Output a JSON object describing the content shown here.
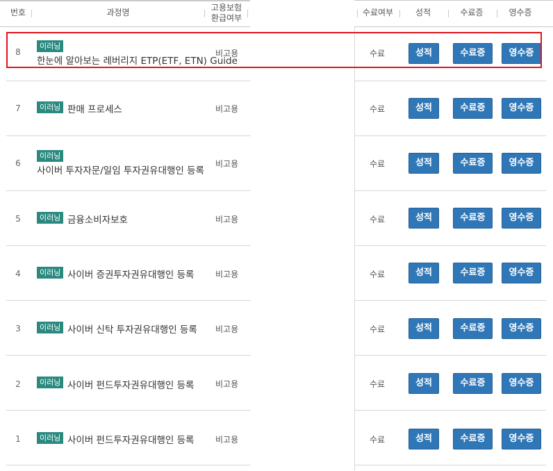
{
  "header": {
    "col_no": "번호",
    "col_course": "과정명",
    "col_insurance_line1": "고용보험",
    "col_insurance_line2": "환급여부",
    "col_completion": "수료여부",
    "col_grade": "성적",
    "col_certificate": "수료증",
    "col_receipt": "영수증"
  },
  "rows": [
    {
      "no": "8",
      "badge": "이러닝",
      "title": "한눈에 알아보는 레버리지 ETP(ETF, ETN) Guide",
      "refund": "비고용",
      "status": "수료",
      "grade_btn": "성적",
      "cert_btn": "수료증",
      "receipt_btn": "영수증"
    },
    {
      "no": "7",
      "badge": "이러닝",
      "title": "판매 프로세스",
      "refund": "비고용",
      "status": "수료",
      "grade_btn": "성적",
      "cert_btn": "수료증",
      "receipt_btn": "영수증"
    },
    {
      "no": "6",
      "badge": "이러닝",
      "title": "사이버 투자자문/일임 투자권유대행인 등록",
      "refund": "비고용",
      "status": "수료",
      "grade_btn": "성적",
      "cert_btn": "수료증",
      "receipt_btn": "영수증"
    },
    {
      "no": "5",
      "badge": "이러닝",
      "title": "금융소비자보호",
      "refund": "비고용",
      "status": "수료",
      "grade_btn": "성적",
      "cert_btn": "수료증",
      "receipt_btn": "영수증"
    },
    {
      "no": "4",
      "badge": "이러닝",
      "title": "사이버 증권투자권유대행인 등록",
      "refund": "비고용",
      "status": "수료",
      "grade_btn": "성적",
      "cert_btn": "수료증",
      "receipt_btn": "영수증"
    },
    {
      "no": "3",
      "badge": "이러닝",
      "title": "사이버 신탁 투자권유대행인 등록",
      "refund": "비고용",
      "status": "수료",
      "grade_btn": "성적",
      "cert_btn": "수료증",
      "receipt_btn": "영수증"
    },
    {
      "no": "2",
      "badge": "이러닝",
      "title": "사이버 펀드투자권유대행인 등록",
      "refund": "비고용",
      "status": "수료",
      "grade_btn": "성적",
      "cert_btn": "수료증",
      "receipt_btn": "영수증"
    },
    {
      "no": "1",
      "badge": "이러닝",
      "title": "사이버 펀드투자권유대행인 등록",
      "refund": "비고용",
      "status": "수료",
      "grade_btn": "성적",
      "cert_btn": "수료증",
      "receipt_btn": "영수증"
    }
  ],
  "colors": {
    "badge": "#2a8a7f",
    "button": "#2f77b7",
    "highlight": "#e0141c"
  }
}
